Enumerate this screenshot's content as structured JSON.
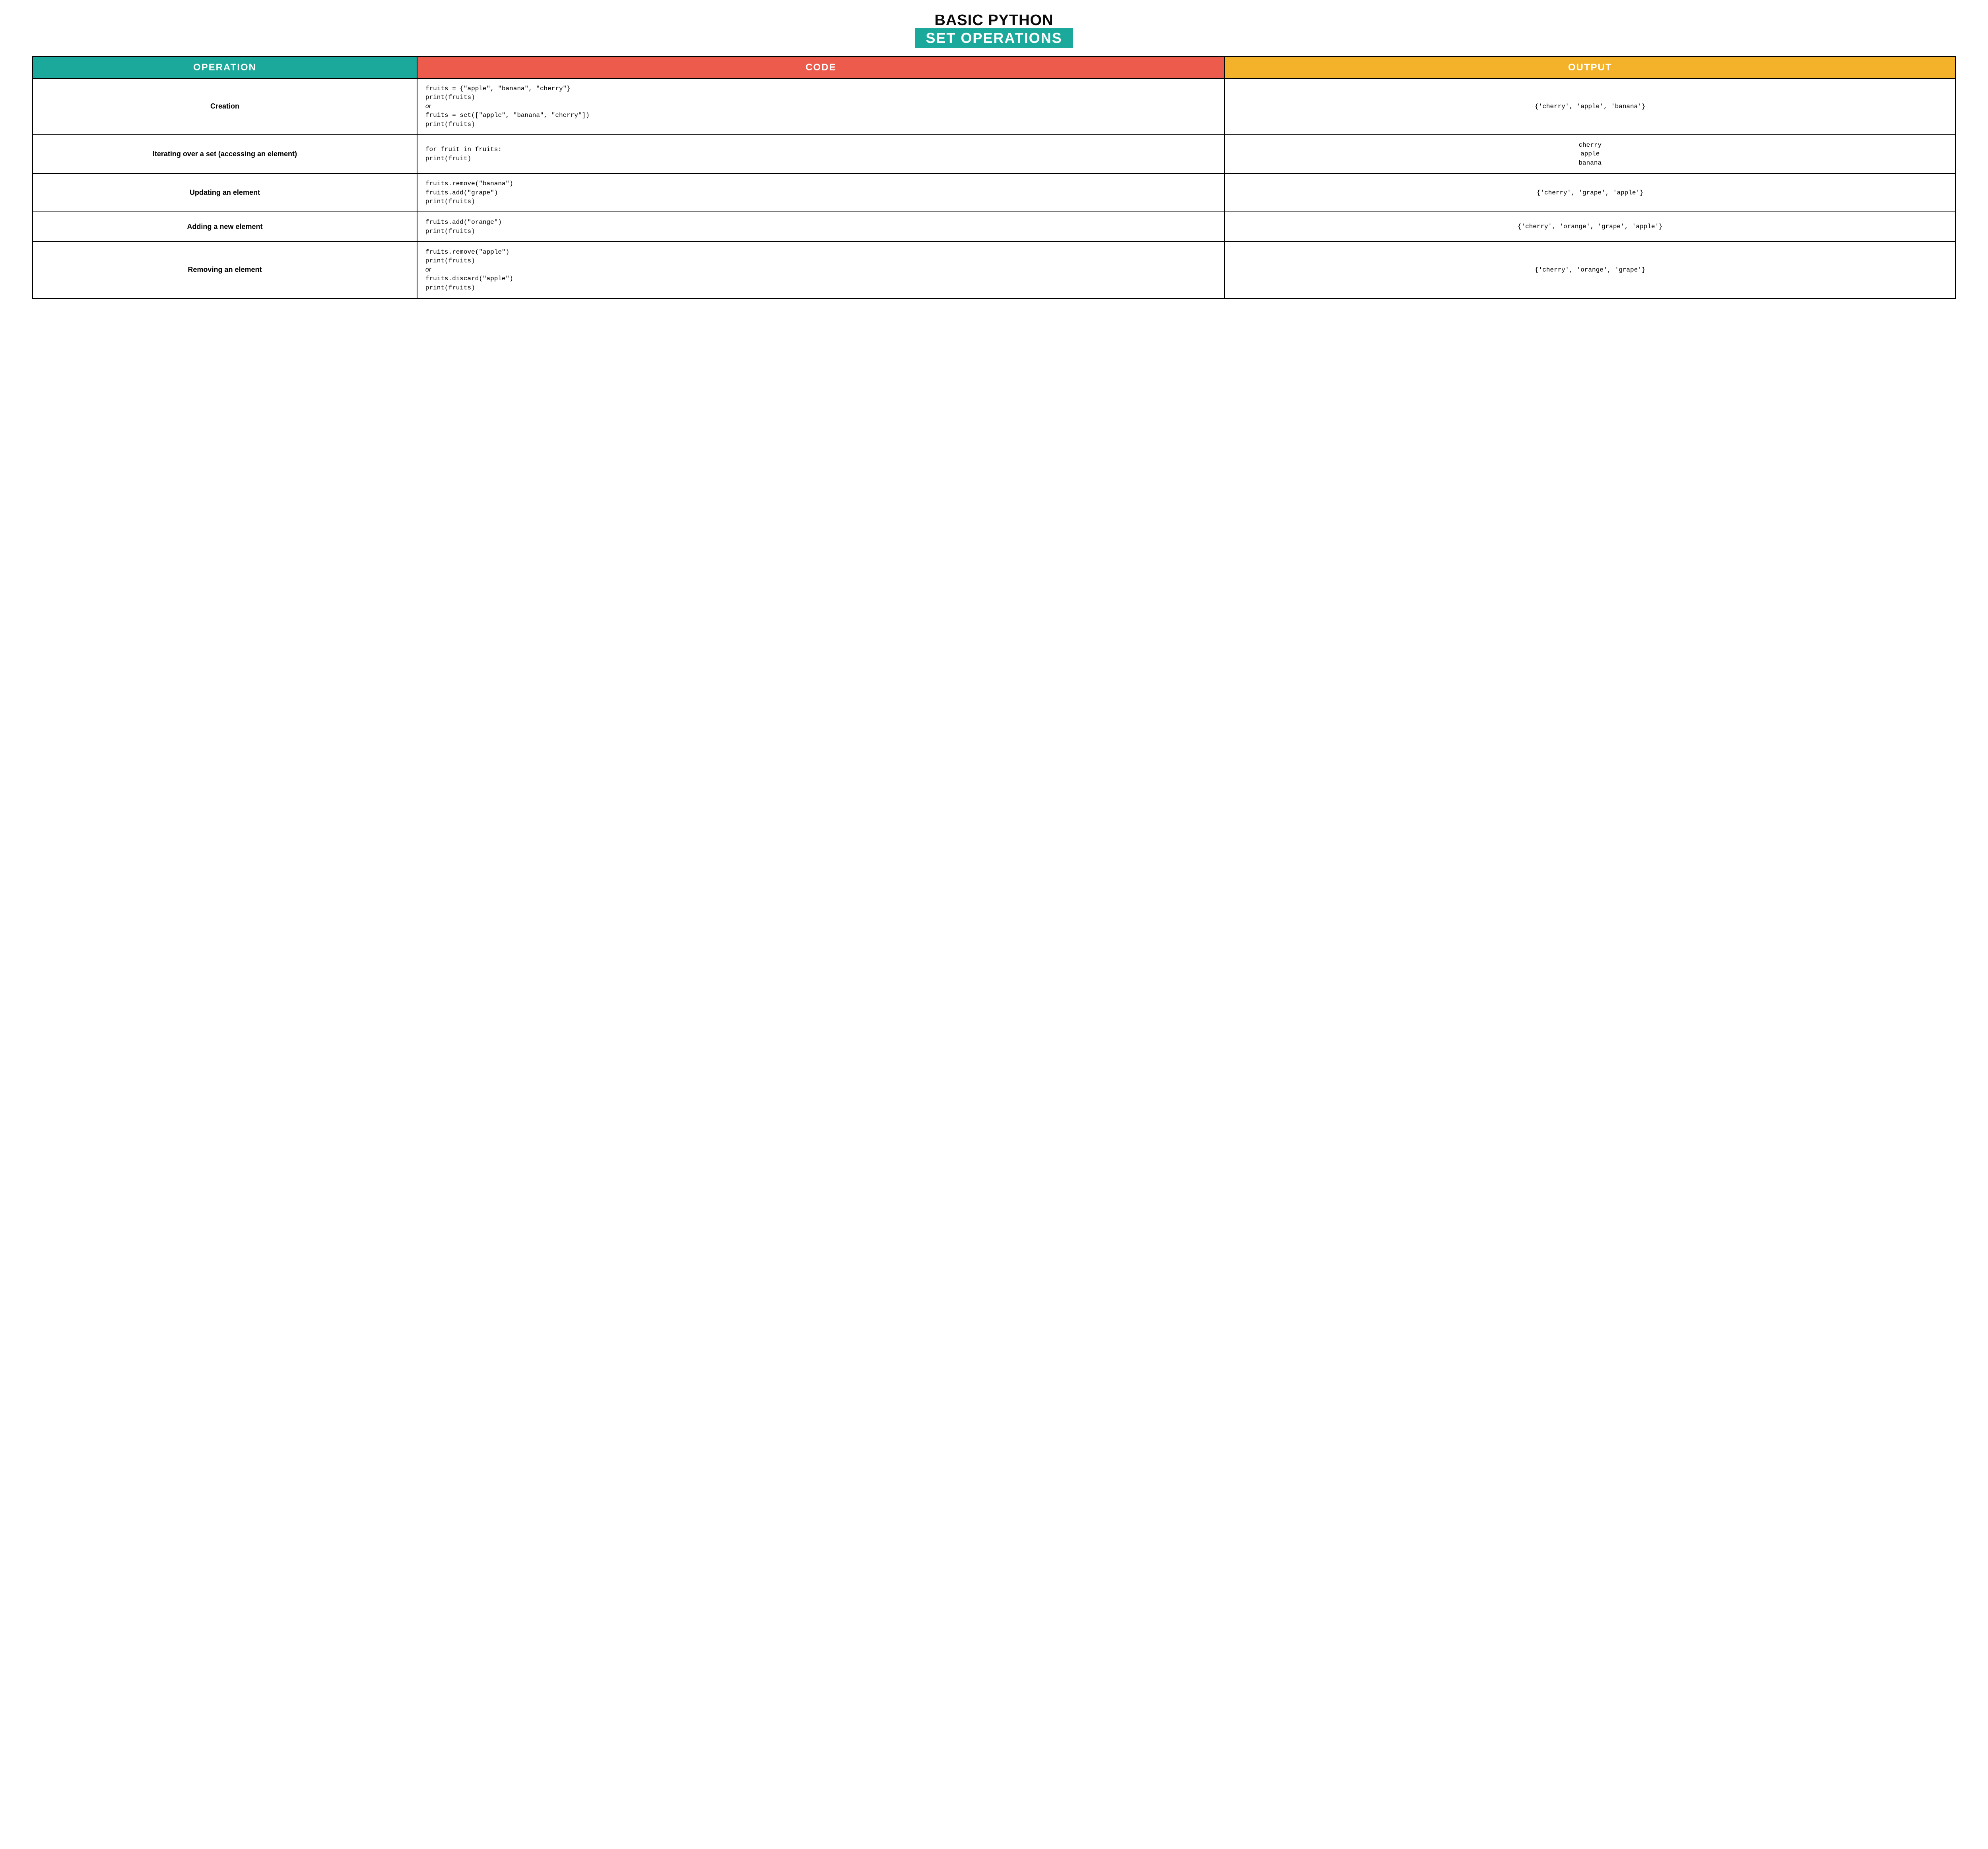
{
  "title": {
    "line1": "BASIC PYTHON",
    "line2": "SET OPERATIONS"
  },
  "headers": {
    "operation": "OPERATION",
    "code": "CODE",
    "output": "OUTPUT"
  },
  "rows": [
    {
      "operation": "Creation",
      "code_part1": "fruits = {\"apple\", \"banana\", \"cherry\"}\nprint(fruits)",
      "or_label": "or",
      "code_part2": "fruits = set([\"apple\", \"banana\", \"cherry\"])\nprint(fruits)",
      "output": "{'cherry', 'apple', 'banana'}"
    },
    {
      "operation": "Iterating over\na set (accessing\nan element)",
      "code_part1": "for fruit in fruits:\nprint(fruit)",
      "output": "cherry\napple\nbanana"
    },
    {
      "operation": "Updating an\nelement",
      "code_part1": "fruits.remove(\"banana\")\nfruits.add(\"grape\")\nprint(fruits)",
      "output": "{'cherry', 'grape', 'apple'}"
    },
    {
      "operation": "Adding a\nnew element",
      "code_part1": "fruits.add(\"orange\")\nprint(fruits)",
      "output": "{'cherry', 'orange', 'grape', 'apple'}"
    },
    {
      "operation": "Removing\nan element",
      "code_part1": "fruits.remove(\"apple\")\nprint(fruits)",
      "or_label": "or",
      "code_part2": "fruits.discard(\"apple\")\nprint(fruits)",
      "output": "{'cherry', 'orange', 'grape'}"
    }
  ]
}
